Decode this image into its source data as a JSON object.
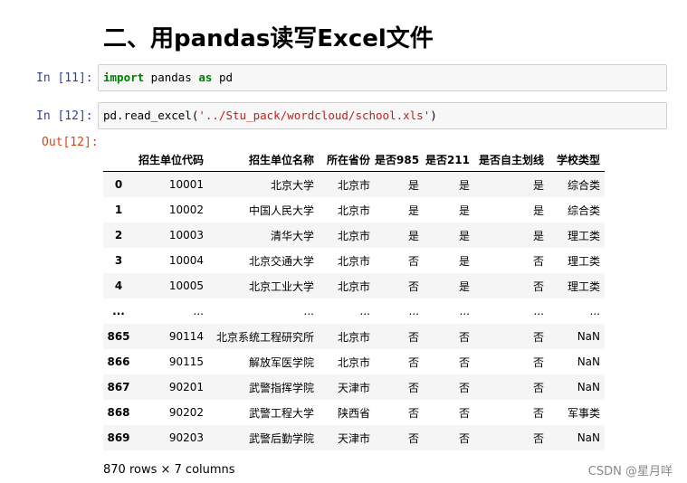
{
  "heading": "二、用pandas读写Excel文件",
  "cells": [
    {
      "prompt": "In  [11]:",
      "tokens": [
        {
          "t": "import",
          "c": "kw"
        },
        {
          "t": " pandas ",
          "c": ""
        },
        {
          "t": "as",
          "c": "kw"
        },
        {
          "t": " pd",
          "c": ""
        }
      ]
    },
    {
      "prompt": "In  [12]:",
      "tokens": [
        {
          "t": "pd.read_excel(",
          "c": ""
        },
        {
          "t": "'../Stu_pack/wordcloud/school.xls'",
          "c": "str"
        },
        {
          "t": ")",
          "c": ""
        }
      ]
    }
  ],
  "output_prompt": "Out[12]:",
  "table": {
    "columns": [
      "",
      "招生单位代码",
      "招生单位名称",
      "所在省份",
      "是否985",
      "是否211",
      "是否自主划线",
      "学校类型"
    ],
    "rows": [
      [
        "0",
        "10001",
        "北京大学",
        "北京市",
        "是",
        "是",
        "是",
        "综合类"
      ],
      [
        "1",
        "10002",
        "中国人民大学",
        "北京市",
        "是",
        "是",
        "是",
        "综合类"
      ],
      [
        "2",
        "10003",
        "清华大学",
        "北京市",
        "是",
        "是",
        "是",
        "理工类"
      ],
      [
        "3",
        "10004",
        "北京交通大学",
        "北京市",
        "否",
        "是",
        "否",
        "理工类"
      ],
      [
        "4",
        "10005",
        "北京工业大学",
        "北京市",
        "否",
        "是",
        "否",
        "理工类"
      ],
      [
        "...",
        "...",
        "...",
        "...",
        "...",
        "...",
        "...",
        "..."
      ],
      [
        "865",
        "90114",
        "北京系统工程研究所",
        "北京市",
        "否",
        "否",
        "否",
        "NaN"
      ],
      [
        "866",
        "90115",
        "解放军医学院",
        "北京市",
        "否",
        "否",
        "否",
        "NaN"
      ],
      [
        "867",
        "90201",
        "武警指挥学院",
        "天津市",
        "否",
        "否",
        "否",
        "NaN"
      ],
      [
        "868",
        "90202",
        "武警工程大学",
        "陕西省",
        "否",
        "否",
        "否",
        "军事类"
      ],
      [
        "869",
        "90203",
        "武警后勤学院",
        "天津市",
        "否",
        "否",
        "否",
        "NaN"
      ]
    ]
  },
  "footer": "870 rows × 7 columns",
  "watermark": "CSDN @星月咩"
}
